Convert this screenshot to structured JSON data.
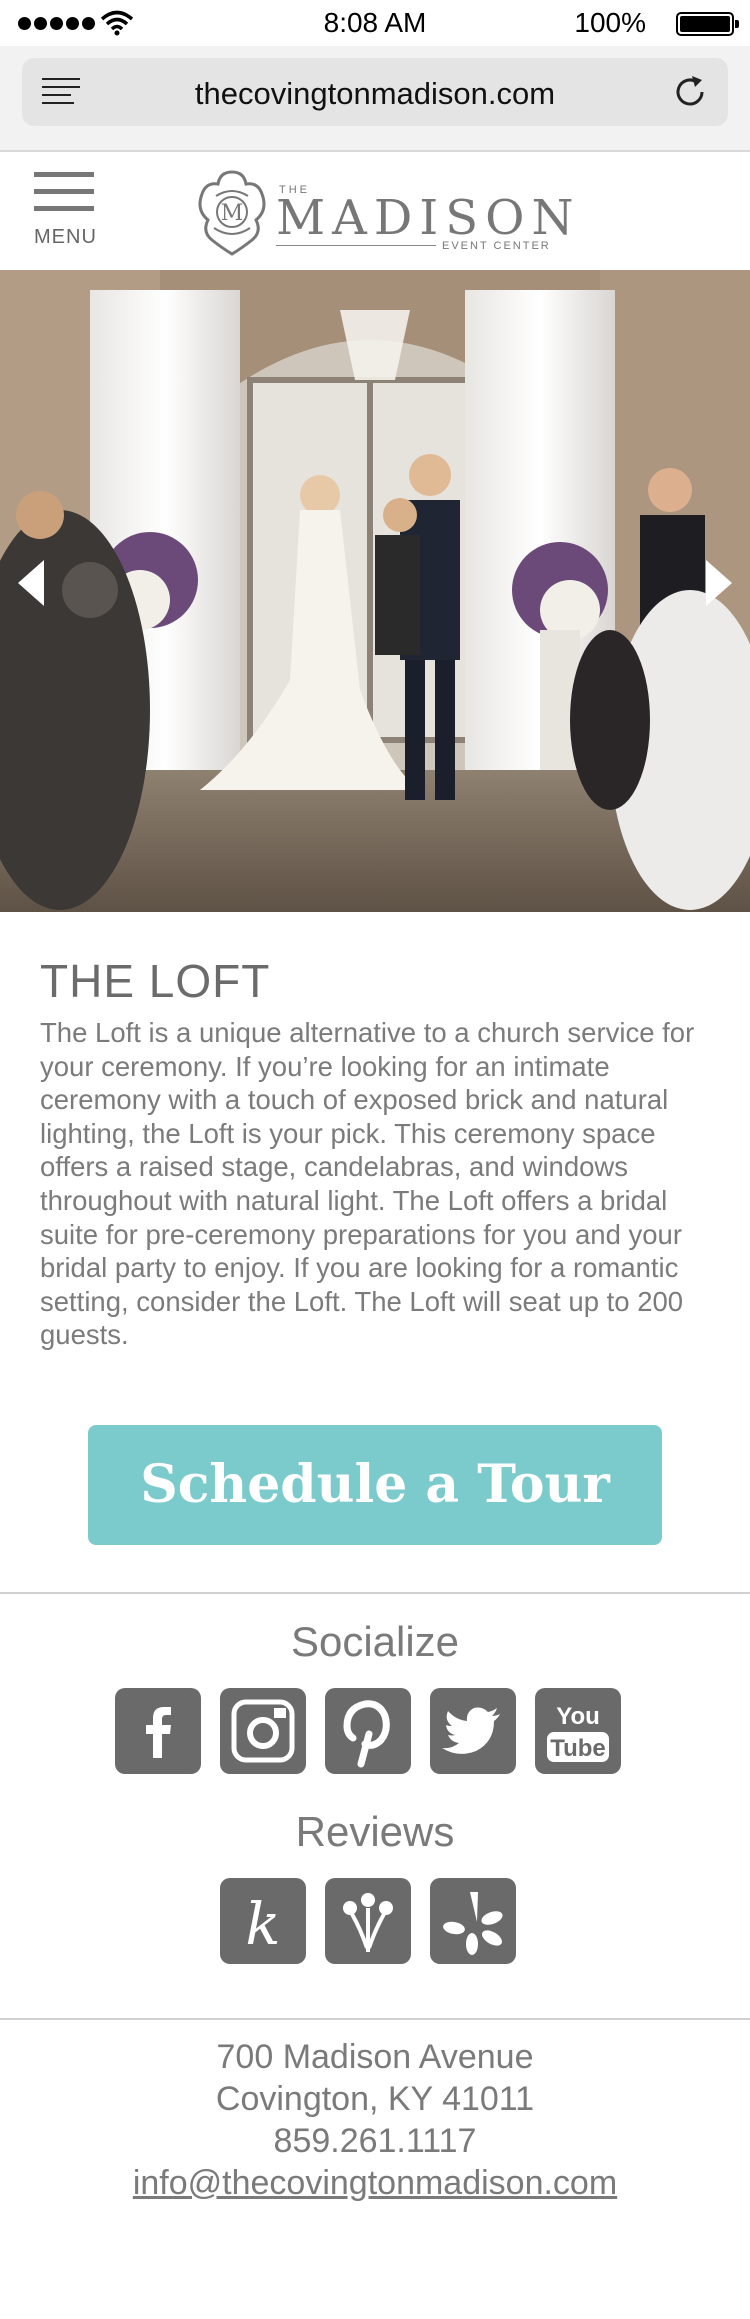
{
  "status_bar": {
    "time": "8:08 AM",
    "battery": "100%"
  },
  "browser": {
    "url": "thecovingtonmadison.com"
  },
  "header": {
    "menu_label": "MENU",
    "logo": {
      "the": "THE",
      "name": "MADISON",
      "sub": "EVENT CENTER",
      "monogram": "M"
    }
  },
  "hero": {
    "image_alt": "Wedding ceremony in the Loft"
  },
  "content": {
    "title": "THE LOFT",
    "description": "The Loft is a unique alternative to a church service for your ceremony. If you’re looking for an intimate ceremony with a touch of exposed brick and natural lighting, the Loft is your pick. This ceremony space offers a raised stage, candelabras, and windows throughout with natural light. The Loft offers a bridal suite for pre-ceremony preparations for you and your bridal party to enjoy. If you are looking for a romantic setting, consider the Loft. The Loft will seat up to 200 guests.",
    "cta_label": "Schedule a Tour"
  },
  "socialize": {
    "title": "Socialize",
    "icons": [
      "facebook-icon",
      "instagram-icon",
      "pinterest-icon",
      "twitter-icon",
      "youtube-icon"
    ],
    "youtube_text": [
      "You",
      "Tube"
    ]
  },
  "reviews": {
    "title": "Reviews",
    "icons": [
      "the-knot-icon",
      "wedding-wire-icon",
      "yelp-icon"
    ],
    "knot_letter": "k"
  },
  "footer": {
    "address_line1": "700 Madison Avenue",
    "address_line2": "Covington, KY 41011",
    "phone": "859.261.1117",
    "email": "info@thecovingtonmadison.com"
  },
  "colors": {
    "accent": "#7ccbcc",
    "icon_gray": "#6a6a6a",
    "text_gray": "#7b7b7b"
  }
}
